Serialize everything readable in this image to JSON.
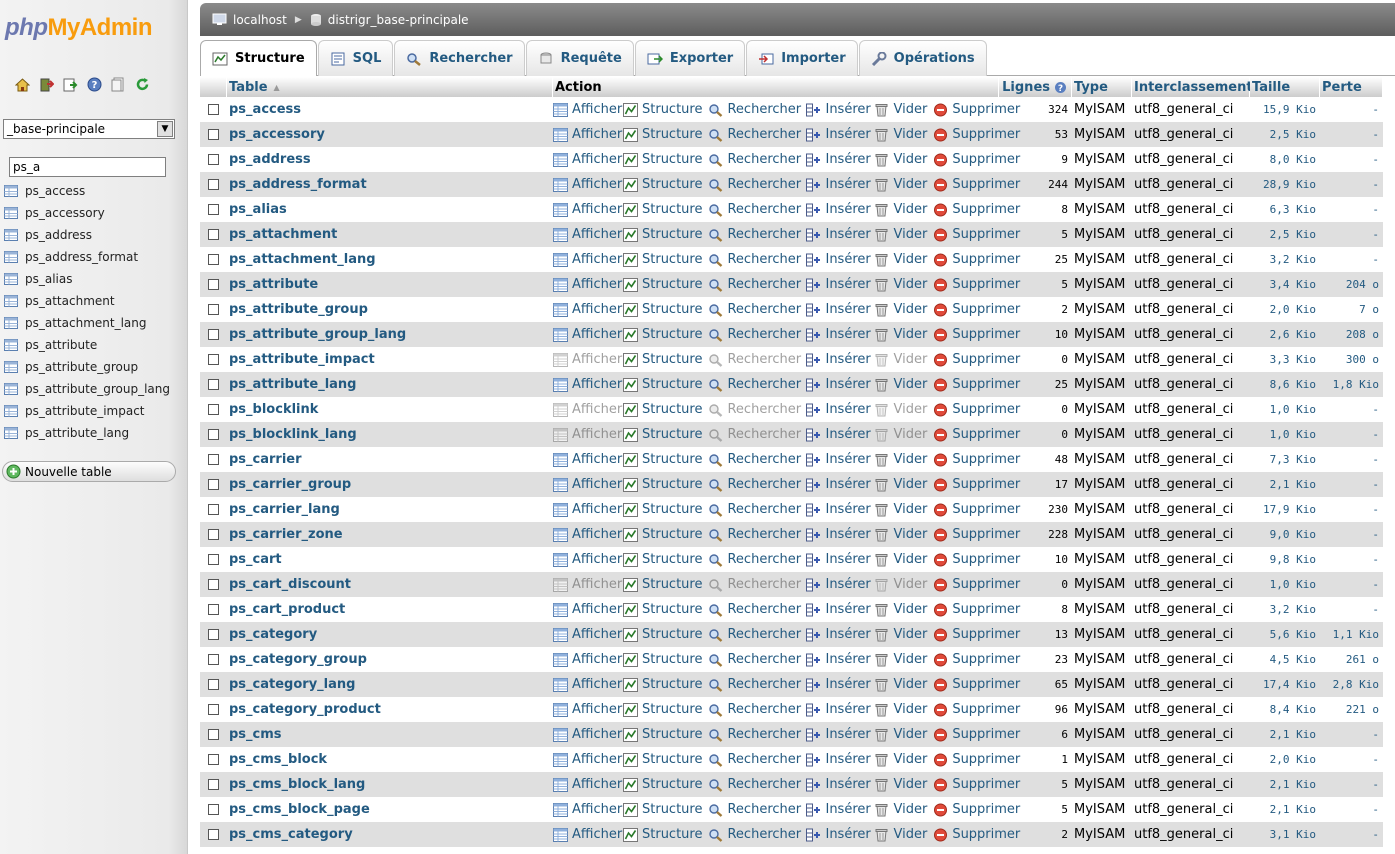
{
  "app": {
    "logo_php": "php",
    "logo_myadmin": "MyAdmin"
  },
  "sidebar": {
    "quick_icons": [
      "home-icon",
      "exit-icon",
      "query-window-icon",
      "help-icon",
      "docs-icon",
      "reload-icon"
    ],
    "db_select": "_base-principale",
    "filter_value": "ps_a",
    "tables": [
      "ps_access",
      "ps_accessory",
      "ps_address",
      "ps_address_format",
      "ps_alias",
      "ps_attachment",
      "ps_attachment_lang",
      "ps_attribute",
      "ps_attribute_group",
      "ps_attribute_group_lang",
      "ps_attribute_impact",
      "ps_attribute_lang"
    ],
    "new_table": "Nouvelle table"
  },
  "breadcrumb": {
    "server": "localhost",
    "database": "distrigr_base-principale"
  },
  "tabs": [
    "Structure",
    "SQL",
    "Rechercher",
    "Requête",
    "Exporter",
    "Importer",
    "Opérations"
  ],
  "columns": {
    "table": "Table",
    "action": "Action",
    "rows": "Lignes",
    "type": "Type",
    "collation": "Interclassement",
    "size": "Taille",
    "overhead": "Perte"
  },
  "actions": [
    "Afficher",
    "Structure",
    "Rechercher",
    "Insérer",
    "Vider",
    "Supprimer"
  ],
  "rows": [
    {
      "name": "ps_access",
      "rows": "324",
      "type": "MyISAM",
      "coll": "utf8_general_ci",
      "size": "15,9 Kio",
      "over": "-",
      "empty": false
    },
    {
      "name": "ps_accessory",
      "rows": "53",
      "type": "MyISAM",
      "coll": "utf8_general_ci",
      "size": "2,5 Kio",
      "over": "-",
      "empty": false
    },
    {
      "name": "ps_address",
      "rows": "9",
      "type": "MyISAM",
      "coll": "utf8_general_ci",
      "size": "8,0 Kio",
      "over": "-",
      "empty": false
    },
    {
      "name": "ps_address_format",
      "rows": "244",
      "type": "MyISAM",
      "coll": "utf8_general_ci",
      "size": "28,9 Kio",
      "over": "-",
      "empty": false
    },
    {
      "name": "ps_alias",
      "rows": "8",
      "type": "MyISAM",
      "coll": "utf8_general_ci",
      "size": "6,3 Kio",
      "over": "-",
      "empty": false
    },
    {
      "name": "ps_attachment",
      "rows": "5",
      "type": "MyISAM",
      "coll": "utf8_general_ci",
      "size": "2,5 Kio",
      "over": "-",
      "empty": false
    },
    {
      "name": "ps_attachment_lang",
      "rows": "25",
      "type": "MyISAM",
      "coll": "utf8_general_ci",
      "size": "3,2 Kio",
      "over": "-",
      "empty": false
    },
    {
      "name": "ps_attribute",
      "rows": "5",
      "type": "MyISAM",
      "coll": "utf8_general_ci",
      "size": "3,4 Kio",
      "over": "204 o",
      "empty": false
    },
    {
      "name": "ps_attribute_group",
      "rows": "2",
      "type": "MyISAM",
      "coll": "utf8_general_ci",
      "size": "2,0 Kio",
      "over": "7 o",
      "empty": false
    },
    {
      "name": "ps_attribute_group_lang",
      "rows": "10",
      "type": "MyISAM",
      "coll": "utf8_general_ci",
      "size": "2,6 Kio",
      "over": "208 o",
      "empty": false
    },
    {
      "name": "ps_attribute_impact",
      "rows": "0",
      "type": "MyISAM",
      "coll": "utf8_general_ci",
      "size": "3,3 Kio",
      "over": "300 o",
      "empty": true
    },
    {
      "name": "ps_attribute_lang",
      "rows": "25",
      "type": "MyISAM",
      "coll": "utf8_general_ci",
      "size": "8,6 Kio",
      "over": "1,8 Kio",
      "empty": false
    },
    {
      "name": "ps_blocklink",
      "rows": "0",
      "type": "MyISAM",
      "coll": "utf8_general_ci",
      "size": "1,0 Kio",
      "over": "-",
      "empty": true
    },
    {
      "name": "ps_blocklink_lang",
      "rows": "0",
      "type": "MyISAM",
      "coll": "utf8_general_ci",
      "size": "1,0 Kio",
      "over": "-",
      "empty": true
    },
    {
      "name": "ps_carrier",
      "rows": "48",
      "type": "MyISAM",
      "coll": "utf8_general_ci",
      "size": "7,3 Kio",
      "over": "-",
      "empty": false
    },
    {
      "name": "ps_carrier_group",
      "rows": "17",
      "type": "MyISAM",
      "coll": "utf8_general_ci",
      "size": "2,1 Kio",
      "over": "-",
      "empty": false
    },
    {
      "name": "ps_carrier_lang",
      "rows": "230",
      "type": "MyISAM",
      "coll": "utf8_general_ci",
      "size": "17,9 Kio",
      "over": "-",
      "empty": false
    },
    {
      "name": "ps_carrier_zone",
      "rows": "228",
      "type": "MyISAM",
      "coll": "utf8_general_ci",
      "size": "9,0 Kio",
      "over": "-",
      "empty": false
    },
    {
      "name": "ps_cart",
      "rows": "10",
      "type": "MyISAM",
      "coll": "utf8_general_ci",
      "size": "9,8 Kio",
      "over": "-",
      "empty": false
    },
    {
      "name": "ps_cart_discount",
      "rows": "0",
      "type": "MyISAM",
      "coll": "utf8_general_ci",
      "size": "1,0 Kio",
      "over": "-",
      "empty": true
    },
    {
      "name": "ps_cart_product",
      "rows": "8",
      "type": "MyISAM",
      "coll": "utf8_general_ci",
      "size": "3,2 Kio",
      "over": "-",
      "empty": false
    },
    {
      "name": "ps_category",
      "rows": "13",
      "type": "MyISAM",
      "coll": "utf8_general_ci",
      "size": "5,6 Kio",
      "over": "1,1 Kio",
      "empty": false
    },
    {
      "name": "ps_category_group",
      "rows": "23",
      "type": "MyISAM",
      "coll": "utf8_general_ci",
      "size": "4,5 Kio",
      "over": "261 o",
      "empty": false
    },
    {
      "name": "ps_category_lang",
      "rows": "65",
      "type": "MyISAM",
      "coll": "utf8_general_ci",
      "size": "17,4 Kio",
      "over": "2,8 Kio",
      "empty": false
    },
    {
      "name": "ps_category_product",
      "rows": "96",
      "type": "MyISAM",
      "coll": "utf8_general_ci",
      "size": "8,4 Kio",
      "over": "221 o",
      "empty": false
    },
    {
      "name": "ps_cms",
      "rows": "6",
      "type": "MyISAM",
      "coll": "utf8_general_ci",
      "size": "2,1 Kio",
      "over": "-",
      "empty": false
    },
    {
      "name": "ps_cms_block",
      "rows": "1",
      "type": "MyISAM",
      "coll": "utf8_general_ci",
      "size": "2,0 Kio",
      "over": "-",
      "empty": false
    },
    {
      "name": "ps_cms_block_lang",
      "rows": "5",
      "type": "MyISAM",
      "coll": "utf8_general_ci",
      "size": "2,1 Kio",
      "over": "-",
      "empty": false
    },
    {
      "name": "ps_cms_block_page",
      "rows": "5",
      "type": "MyISAM",
      "coll": "utf8_general_ci",
      "size": "2,1 Kio",
      "over": "-",
      "empty": false
    },
    {
      "name": "ps_cms_category",
      "rows": "2",
      "type": "MyISAM",
      "coll": "utf8_general_ci",
      "size": "3,1 Kio",
      "over": "-",
      "empty": false
    }
  ]
}
